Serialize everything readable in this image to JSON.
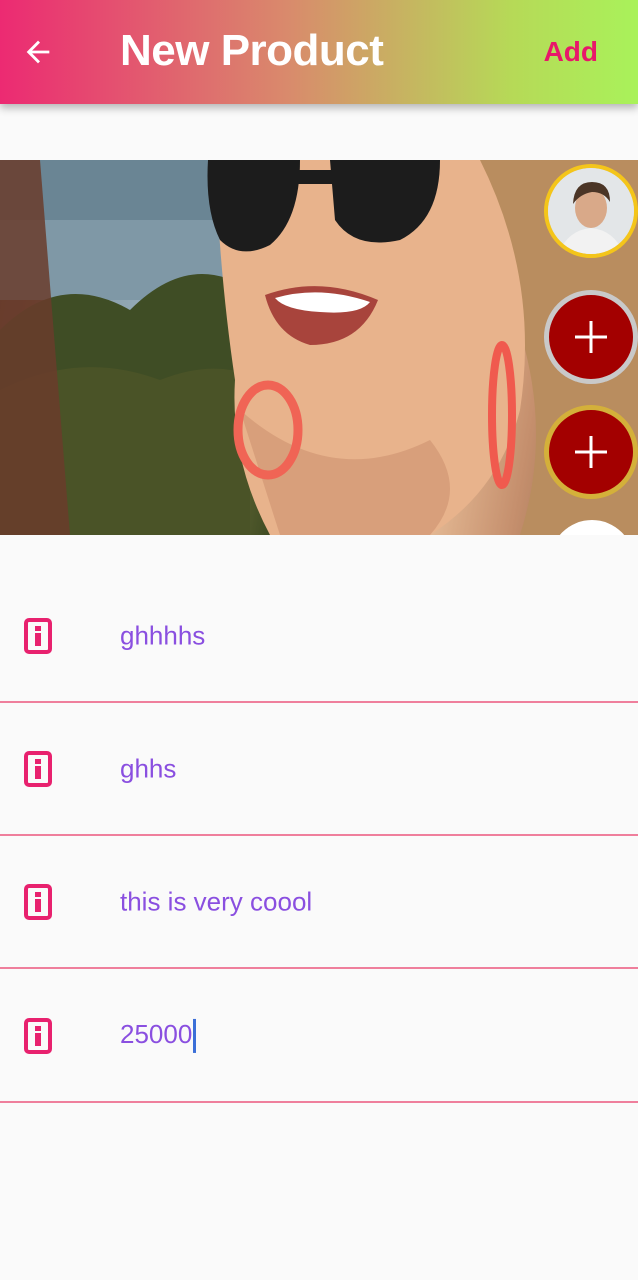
{
  "app_bar": {
    "title": "New Product",
    "back_icon": "arrow-left-icon",
    "add_label": "Add",
    "colors": {
      "gradient_start": "#ec2a72",
      "gradient_end": "#a9f25a",
      "add_color": "#e8186a"
    }
  },
  "hero": {
    "image_description": "woman-smiling-sunglasses-photo"
  },
  "side_actions": {
    "avatar_icon": "user-avatar-icon",
    "add_icon": "plus-icon",
    "colors": {
      "fab_bg": "#a30000",
      "avatar_ring": "#f4c51a"
    }
  },
  "form": {
    "fields": [
      {
        "icon": "info-icon",
        "value": "ghhhhs"
      },
      {
        "icon": "info-icon",
        "value": "ghhs"
      },
      {
        "icon": "info-icon",
        "value": "this is very coool"
      },
      {
        "icon": "info-icon",
        "value": "25000"
      }
    ],
    "colors": {
      "value_text": "#8a4fe0",
      "divider": "#ef7f9c",
      "icon": "#e8216e"
    }
  }
}
